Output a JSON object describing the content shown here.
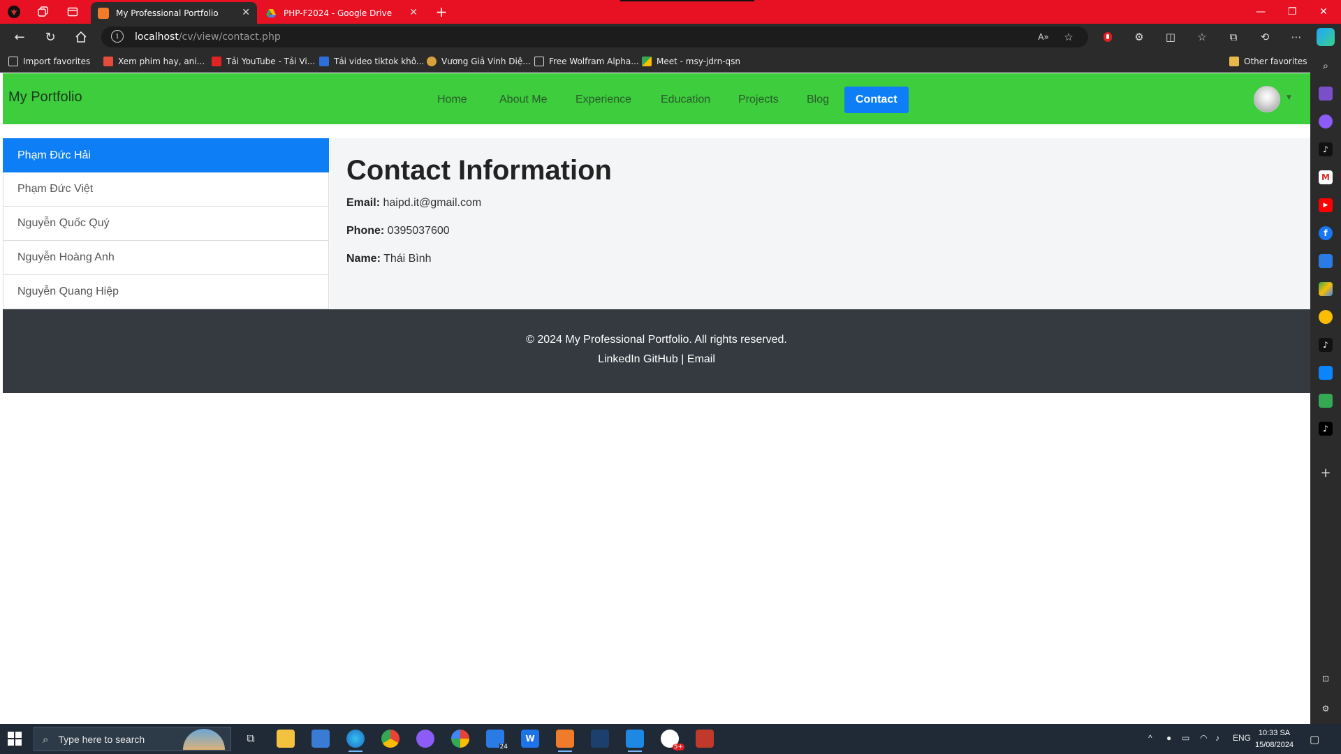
{
  "browser": {
    "tabs": [
      {
        "title": "My Professional Portfolio",
        "active": true
      },
      {
        "title": "PHP-F2024 - Google Drive",
        "active": false
      }
    ],
    "address": {
      "host": "localhost",
      "path": "/cv/view/contact.php"
    },
    "favorites": [
      {
        "label": "Import favorites",
        "icon": "import-icon"
      },
      {
        "label": "Xem phim hay, ani...",
        "icon": "site-icon"
      },
      {
        "label": "Tải YouTube - Tải Vi...",
        "icon": "download-icon"
      },
      {
        "label": "Tải video tiktok khô...",
        "icon": "download-icon"
      },
      {
        "label": "Vương Giả Vinh Diệ...",
        "icon": "game-icon"
      },
      {
        "label": "Free Wolfram Alpha...",
        "icon": "page-icon"
      },
      {
        "label": "Meet - msy-jdrn-qsn",
        "icon": "meet-icon"
      }
    ],
    "other_favorites": "Other favorites"
  },
  "site": {
    "brand": "My Portfolio",
    "nav": [
      {
        "label": "Home",
        "active": false
      },
      {
        "label": "About Me",
        "active": false
      },
      {
        "label": "Experience",
        "active": false
      },
      {
        "label": "Education",
        "active": false
      },
      {
        "label": "Projects",
        "active": false
      },
      {
        "label": "Blog",
        "active": false
      },
      {
        "label": "Contact",
        "active": true
      }
    ],
    "people": [
      {
        "name": "Phạm Đức Hải",
        "active": true
      },
      {
        "name": "Phạm Đức Việt",
        "active": false
      },
      {
        "name": "Nguyễn Quốc Quý",
        "active": false
      },
      {
        "name": "Nguyễn Hoàng Anh",
        "active": false
      },
      {
        "name": "Nguyễn Quang Hiệp",
        "active": false
      }
    ],
    "contact": {
      "title": "Contact Information",
      "email_label": "Email:",
      "email": "haipd.it@gmail.com",
      "phone_label": "Phone:",
      "phone": "0395037600",
      "name_label": "Name:",
      "name": "Thái Bình"
    },
    "footer": {
      "copyright": "© 2024 My Professional Portfolio. All rights reserved.",
      "links": [
        "LinkedIn",
        "GitHub",
        "Email"
      ],
      "separator": "|"
    }
  },
  "taskbar": {
    "search_placeholder": "Type here to search",
    "language": "ENG",
    "time": "10:33 SA",
    "date": "15/08/2024",
    "badge_24": "24",
    "badge_5": "5+"
  },
  "colors": {
    "browser_frame": "#e81123",
    "navbar_bg": "#3dcd3d",
    "accent_blue": "#0d7ef5",
    "footer_bg": "#343a40",
    "panel_bg": "#f4f5f7"
  }
}
